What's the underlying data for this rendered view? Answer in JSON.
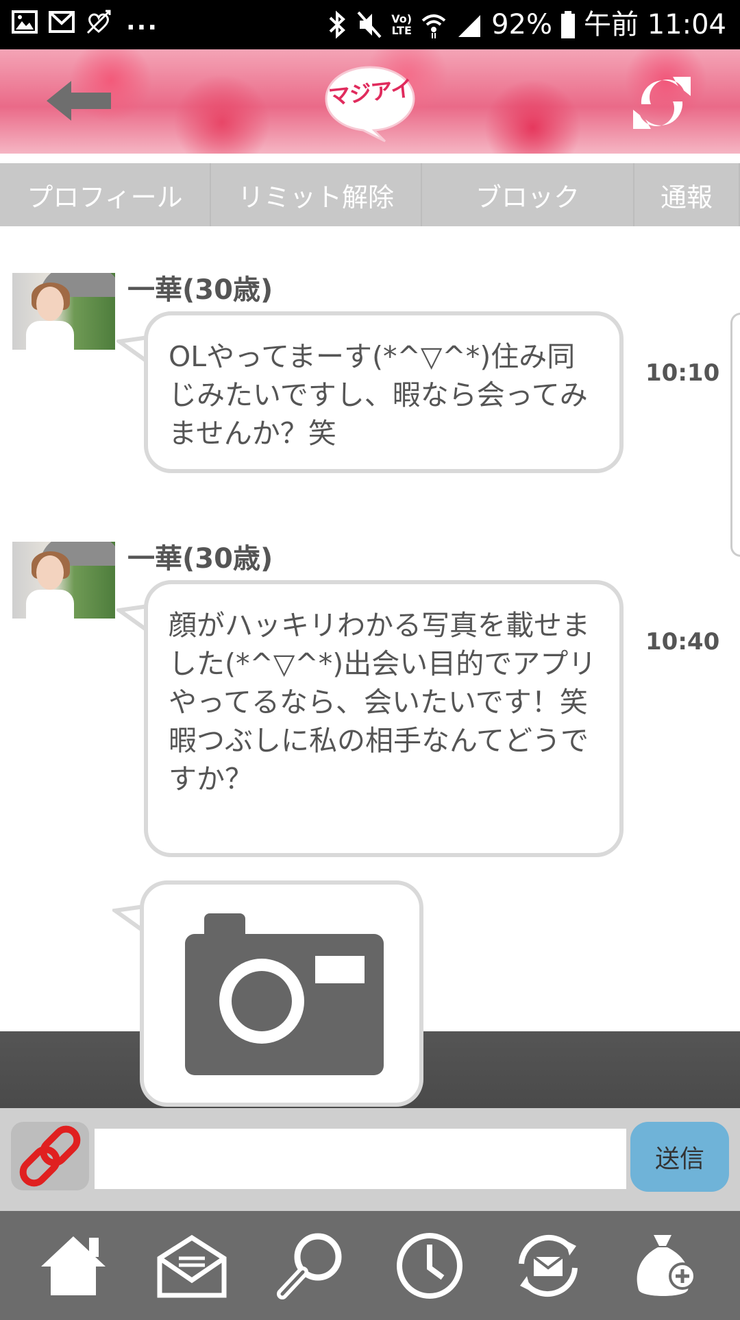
{
  "status_bar": {
    "battery": "92%",
    "time": "午前 11:04",
    "more": "...",
    "lte_top": "Vo)",
    "lte_bottom": "LTE"
  },
  "header": {
    "logo_text": "マジアイ",
    "brand_color": "#e02b5d"
  },
  "tabs": [
    {
      "label": "プロフィール"
    },
    {
      "label": "リミット解除"
    },
    {
      "label": "ブロック"
    },
    {
      "label": "通報"
    }
  ],
  "messages": [
    {
      "sender": "一華(30歳)",
      "text": "OLやってまーす(*^▽^*)住み同じみたいですし、暇なら会ってみませんか？笑",
      "time": "10:10"
    },
    {
      "sender": "一華(30歳)",
      "text": "顔がハッキリわかる写真を載せました(*^▽^*)出会い目的でアプリやってるなら、会いたいです！笑\n暇つぶしに私の相手なんてどうですか？",
      "time": "10:40"
    }
  ],
  "composer": {
    "input_value": "",
    "send_label": "送信"
  },
  "nav": [
    {
      "icon": "home-icon"
    },
    {
      "icon": "mail-icon"
    },
    {
      "icon": "search-icon"
    },
    {
      "icon": "clock-icon"
    },
    {
      "icon": "mail-refresh-icon"
    },
    {
      "icon": "bag-plus-icon"
    }
  ],
  "colors": {
    "tab_bg": "#c8c8c8",
    "send_button": "#6fb3d8",
    "nav_bg": "#6c6c6c"
  }
}
